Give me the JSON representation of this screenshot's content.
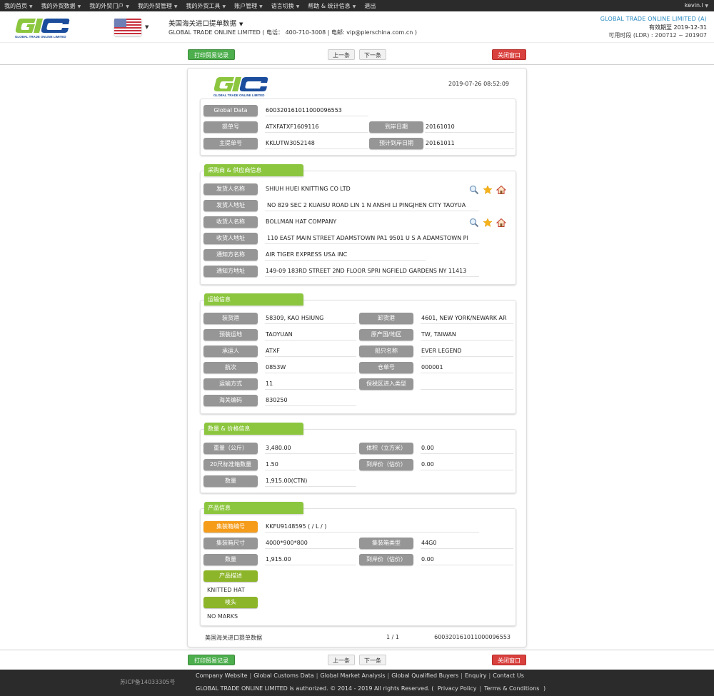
{
  "topnav": {
    "items": [
      {
        "label": "我的首页"
      },
      {
        "label": "我的外贸数据"
      },
      {
        "label": "我的外贸门户"
      },
      {
        "label": "我的外贸管理"
      },
      {
        "label": "我的外贸工具"
      },
      {
        "label": "账户管理"
      },
      {
        "label": "语言切换"
      },
      {
        "label": "帮助 & 统计信息"
      },
      {
        "label": "退出"
      }
    ],
    "user": "kevin.l"
  },
  "header": {
    "logo_text": "GLOBAL TRADE ONLINE LIMITED",
    "country_flag": "us-flag-icon",
    "title": "美国海关进口提单数据",
    "subtitle": "GLOBAL TRADE ONLINE LIMITED ( 电话： 400-710-3008 | 电邮:  vip@pierschina.com.cn )",
    "company": "GLOBAL TRADE ONLINE LIMITED (A)",
    "expire": "有效期至 2019-12-31",
    "ldr": "可用时段 (LDR) : 200712 ~ 201907"
  },
  "toolbar": {
    "print_label": "打印贸易记录",
    "prev_label": "上一条",
    "next_label": "下一条",
    "close_label": "关闭窗口"
  },
  "record": {
    "timestamp": "2019-07-26 08:52:09",
    "basic": {
      "global_data_label": "Global Data",
      "global_data": "600320161011000096553",
      "bill_no_label": "提单号",
      "bill_no": "ATXFATXF1609116",
      "arrival_date_label": "到岸日期",
      "arrival_date": "20161010",
      "master_bill_label": "主提单号",
      "master_bill": "KKLUTW3052148",
      "est_arrival_label": "预计到岸日期",
      "est_arrival": "20161011"
    },
    "parties": {
      "title": "采购商 & 供应商信息",
      "shipper_name_label": "发货人名称",
      "shipper_name": "SHIUH HUEI KNITTING CO LTD",
      "shipper_addr_label": "发货人地址",
      "shipper_addr": "NO 829 SEC 2 KUAISU ROAD LIN 1 N ANSHI LI PINGJHEN CITY TAOYUA",
      "consignee_name_label": "收货人名称",
      "consignee_name": "BOLLMAN HAT COMPANY",
      "consignee_addr_label": "收货人地址",
      "consignee_addr": "110 EAST MAIN STREET ADAMSTOWN PA1 9501 U S A ADAMSTOWN PI",
      "notify_name_label": "通知方名称",
      "notify_name": "AIR TIGER EXPRESS USA INC",
      "notify_addr_label": "通知方地址",
      "notify_addr": "149-09 183RD STREET 2ND FLOOR SPRI NGFIELD GARDENS NY 11413"
    },
    "transport": {
      "title": "运输信息",
      "loading_port_label": "装货港",
      "loading_port": "58309, KAO HSIUNG",
      "unloading_port_label": "卸货港",
      "unloading_port": "4601, NEW YORK/NEWARK AR",
      "pre_carriage_label": "预装运地",
      "pre_carriage": "TAOYUAN",
      "origin_label": "原产国/地区",
      "origin": "TW, TAIWAN",
      "carrier_label": "承运人",
      "carrier": "ATXF",
      "vessel_label": "船只名称",
      "vessel": "EVER LEGEND",
      "voyage_label": "航次",
      "voyage": "0853W",
      "warehouse_label": "仓单号",
      "warehouse": "000001",
      "mode_label": "运输方式",
      "mode": "11",
      "bonded_label": "保税区进入类型",
      "bonded": "",
      "customs_code_label": "海关编码",
      "customs_code": "830250"
    },
    "quantity": {
      "title": "数量 & 价格信息",
      "weight_label": "重量（公斤）",
      "weight": "3,480.00",
      "volume_label": "体积（立方米）",
      "volume": "0.00",
      "teu_label": "20尺标准箱数量",
      "teu": "1.50",
      "value_label": "到岸价（估价）",
      "value": "0.00",
      "qty_label": "数量",
      "qty": "1,915.00(CTN)"
    },
    "product": {
      "title": "产品信息",
      "container_no_label": "集装箱编号",
      "container_no": "KKFU9148595 ( / L / )",
      "container_size_label": "集装箱尺寸",
      "container_size": "4000*900*800",
      "container_type_label": "集装箱类型",
      "container_type": "44G0",
      "qty_label": "数量",
      "qty": "1,915.00",
      "value_label": "到岸价（估价）",
      "value": "0.00",
      "desc_label": "产品描述",
      "desc": "KNITTED HAT",
      "marks_label": "唛头",
      "marks": "NO MARKS"
    },
    "footer": {
      "source": "美国海关进口提单数据",
      "page": "1 / 1",
      "id": "600320161011000096553"
    }
  },
  "footer": {
    "icp": "苏ICP备14033305号",
    "links": [
      "Company Website",
      "Global Customs Data",
      "Global Market Analysis",
      "Global Qualified Buyers",
      "Enquiry",
      "Contact Us"
    ],
    "copyright": "GLOBAL TRADE ONLINE LIMITED is authorized. © 2014 - 2019 All rights Reserved.  (",
    "privacy": "Privacy Policy",
    "terms": "Terms & Conditions",
    "close_paren": ")"
  }
}
